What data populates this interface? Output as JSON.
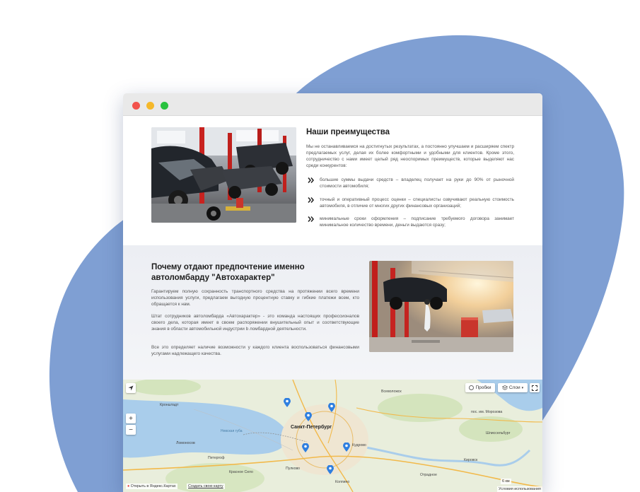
{
  "advantages": {
    "title": "Наши преимущества",
    "intro": "Мы не останавливаемся на достигнутых результатах, а постоянно улучшаем и расширяем спектр предлагаемых услуг, делая их более комфортными и удобными для клиентов. Кроме этого, сотрудничество с нами имеет целый ряд неоспоримых преимуществ, которые выделяют нас среди конкурентов:",
    "bullets": [
      "большие суммы выдачи средств – владелец получает на руки до 90% от рыночной стоимости автомобиля;",
      "точный и оперативный процесс оценки – специалисты озвучивают реальную стоимость автомобиля, в отличие от многих других финансовых организаций;",
      "минимальные сроки оформления – подписание требуемого договора занимает минимальное количество времени, деньги выдаются сразу;"
    ]
  },
  "why": {
    "title": "Почему отдают предпочтение именно автоломбарду \"Автохарактер\"",
    "paragraphs": [
      "Гарантируем полную сохранность транспортного средства на протяжении всего времени использования услуги, предлагаем выгодную процентную ставку и гибкие платежи всем, кто обращается к нам.",
      "Штат сотрудников автоломбарда «Автохарактер» - это команда настоящих профессионалов своего дела, которая имеет в своем распоряжении внушительный опыт и соответствующие знания в области автомобильной индустрии b ломбардной деятельности.",
      "Все это определяет наличие возможности у каждого клиента воспользоваться финансовыми услугами надлежащего качества."
    ]
  },
  "map": {
    "traffic_label": "Пробки",
    "layers_label": "Слои",
    "zoom_in": "+",
    "zoom_out": "−",
    "scale": "6 км",
    "open_in_yandex": "Открыть в Яндекс.Картах",
    "create_map": "Создать свою карту",
    "terms": "Условия использования",
    "places": {
      "spb": "Санкт-Петербург",
      "kronshtadt": "Кронштадт",
      "vsevolozhsk": "Всеволожск",
      "lomonosov": "Ломоносов",
      "peterhof": "Петергоф",
      "kirovsk": "Кировск",
      "shlisselburg": "Шлиссельбург",
      "kudrovo": "Кудрово",
      "kolpino": "Колпино",
      "morozova": "пос. им. Морозова",
      "nevskaya": "Невская губа",
      "otradnoe": "Отрадное",
      "pulkovo": "Пулково",
      "krasnoe": "Красное Село"
    }
  },
  "colors": {
    "blob": "#7f9fd3",
    "accent_red": "#f2524c",
    "accent_yellow": "#f5b82a",
    "accent_green": "#29c23f",
    "map_pin": "#2f7fe0"
  },
  "icons": [
    "chevron-double-icon",
    "geolocation-icon",
    "fullscreen-icon",
    "layers-icon",
    "traffic-icon",
    "map-pin-icon"
  ]
}
